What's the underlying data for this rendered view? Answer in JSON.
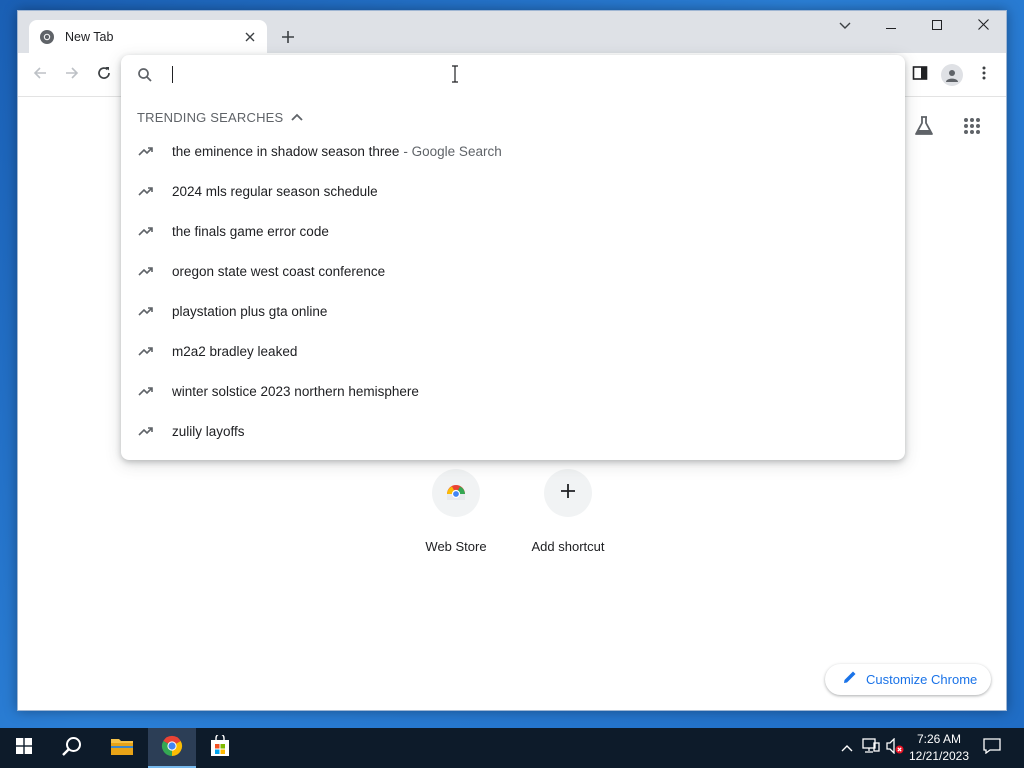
{
  "tab": {
    "title": "New Tab"
  },
  "omnibox": {
    "value": "",
    "placeholder": ""
  },
  "trending": {
    "header": "TRENDING SEARCHES",
    "items": [
      {
        "text": "the eminence in shadow season three",
        "suffix": "- Google Search"
      },
      {
        "text": "2024 mls regular season schedule",
        "suffix": ""
      },
      {
        "text": "the finals game error code",
        "suffix": ""
      },
      {
        "text": "oregon state west coast conference",
        "suffix": ""
      },
      {
        "text": "playstation plus gta online",
        "suffix": ""
      },
      {
        "text": "m2a2 bradley leaked",
        "suffix": ""
      },
      {
        "text": "winter solstice 2023 northern hemisphere",
        "suffix": ""
      },
      {
        "text": "zulily layoffs",
        "suffix": ""
      }
    ]
  },
  "shortcuts": [
    {
      "label": "Web Store",
      "icon": "chrome-web-store-icon"
    },
    {
      "label": "Add shortcut",
      "icon": "plus-icon"
    }
  ],
  "customize": {
    "label": "Customize Chrome"
  },
  "taskbar": {
    "time": "7:26 AM",
    "date": "12/21/2023",
    "apps": [
      "start-icon",
      "search-icon",
      "file-explorer-icon",
      "chrome-icon",
      "store-icon"
    ]
  },
  "colors": {
    "accent": "#1a73e8",
    "titlebar": "#dee1e6",
    "taskbar": "#0d1b2a",
    "desktop": "#1f6cc4"
  }
}
